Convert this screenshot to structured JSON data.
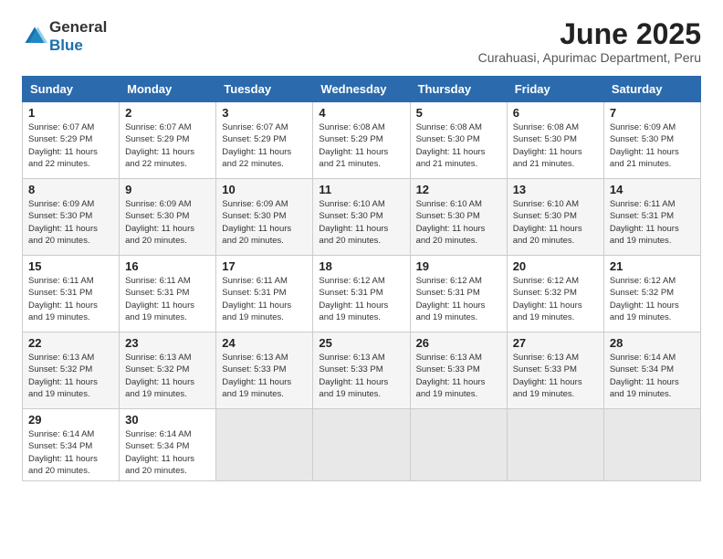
{
  "logo": {
    "general": "General",
    "blue": "Blue"
  },
  "title": "June 2025",
  "subtitle": "Curahuasi, Apurimac Department, Peru",
  "headers": [
    "Sunday",
    "Monday",
    "Tuesday",
    "Wednesday",
    "Thursday",
    "Friday",
    "Saturday"
  ],
  "weeks": [
    [
      {
        "day": "1",
        "info": "Sunrise: 6:07 AM\nSunset: 5:29 PM\nDaylight: 11 hours\nand 22 minutes."
      },
      {
        "day": "2",
        "info": "Sunrise: 6:07 AM\nSunset: 5:29 PM\nDaylight: 11 hours\nand 22 minutes."
      },
      {
        "day": "3",
        "info": "Sunrise: 6:07 AM\nSunset: 5:29 PM\nDaylight: 11 hours\nand 22 minutes."
      },
      {
        "day": "4",
        "info": "Sunrise: 6:08 AM\nSunset: 5:29 PM\nDaylight: 11 hours\nand 21 minutes."
      },
      {
        "day": "5",
        "info": "Sunrise: 6:08 AM\nSunset: 5:30 PM\nDaylight: 11 hours\nand 21 minutes."
      },
      {
        "day": "6",
        "info": "Sunrise: 6:08 AM\nSunset: 5:30 PM\nDaylight: 11 hours\nand 21 minutes."
      },
      {
        "day": "7",
        "info": "Sunrise: 6:09 AM\nSunset: 5:30 PM\nDaylight: 11 hours\nand 21 minutes."
      }
    ],
    [
      {
        "day": "8",
        "info": "Sunrise: 6:09 AM\nSunset: 5:30 PM\nDaylight: 11 hours\nand 20 minutes."
      },
      {
        "day": "9",
        "info": "Sunrise: 6:09 AM\nSunset: 5:30 PM\nDaylight: 11 hours\nand 20 minutes."
      },
      {
        "day": "10",
        "info": "Sunrise: 6:09 AM\nSunset: 5:30 PM\nDaylight: 11 hours\nand 20 minutes."
      },
      {
        "day": "11",
        "info": "Sunrise: 6:10 AM\nSunset: 5:30 PM\nDaylight: 11 hours\nand 20 minutes."
      },
      {
        "day": "12",
        "info": "Sunrise: 6:10 AM\nSunset: 5:30 PM\nDaylight: 11 hours\nand 20 minutes."
      },
      {
        "day": "13",
        "info": "Sunrise: 6:10 AM\nSunset: 5:30 PM\nDaylight: 11 hours\nand 20 minutes."
      },
      {
        "day": "14",
        "info": "Sunrise: 6:11 AM\nSunset: 5:31 PM\nDaylight: 11 hours\nand 19 minutes."
      }
    ],
    [
      {
        "day": "15",
        "info": "Sunrise: 6:11 AM\nSunset: 5:31 PM\nDaylight: 11 hours\nand 19 minutes."
      },
      {
        "day": "16",
        "info": "Sunrise: 6:11 AM\nSunset: 5:31 PM\nDaylight: 11 hours\nand 19 minutes."
      },
      {
        "day": "17",
        "info": "Sunrise: 6:11 AM\nSunset: 5:31 PM\nDaylight: 11 hours\nand 19 minutes."
      },
      {
        "day": "18",
        "info": "Sunrise: 6:12 AM\nSunset: 5:31 PM\nDaylight: 11 hours\nand 19 minutes."
      },
      {
        "day": "19",
        "info": "Sunrise: 6:12 AM\nSunset: 5:31 PM\nDaylight: 11 hours\nand 19 minutes."
      },
      {
        "day": "20",
        "info": "Sunrise: 6:12 AM\nSunset: 5:32 PM\nDaylight: 11 hours\nand 19 minutes."
      },
      {
        "day": "21",
        "info": "Sunrise: 6:12 AM\nSunset: 5:32 PM\nDaylight: 11 hours\nand 19 minutes."
      }
    ],
    [
      {
        "day": "22",
        "info": "Sunrise: 6:13 AM\nSunset: 5:32 PM\nDaylight: 11 hours\nand 19 minutes."
      },
      {
        "day": "23",
        "info": "Sunrise: 6:13 AM\nSunset: 5:32 PM\nDaylight: 11 hours\nand 19 minutes."
      },
      {
        "day": "24",
        "info": "Sunrise: 6:13 AM\nSunset: 5:33 PM\nDaylight: 11 hours\nand 19 minutes."
      },
      {
        "day": "25",
        "info": "Sunrise: 6:13 AM\nSunset: 5:33 PM\nDaylight: 11 hours\nand 19 minutes."
      },
      {
        "day": "26",
        "info": "Sunrise: 6:13 AM\nSunset: 5:33 PM\nDaylight: 11 hours\nand 19 minutes."
      },
      {
        "day": "27",
        "info": "Sunrise: 6:13 AM\nSunset: 5:33 PM\nDaylight: 11 hours\nand 19 minutes."
      },
      {
        "day": "28",
        "info": "Sunrise: 6:14 AM\nSunset: 5:34 PM\nDaylight: 11 hours\nand 19 minutes."
      }
    ],
    [
      {
        "day": "29",
        "info": "Sunrise: 6:14 AM\nSunset: 5:34 PM\nDaylight: 11 hours\nand 20 minutes."
      },
      {
        "day": "30",
        "info": "Sunrise: 6:14 AM\nSunset: 5:34 PM\nDaylight: 11 hours\nand 20 minutes."
      },
      {
        "day": "",
        "info": ""
      },
      {
        "day": "",
        "info": ""
      },
      {
        "day": "",
        "info": ""
      },
      {
        "day": "",
        "info": ""
      },
      {
        "day": "",
        "info": ""
      }
    ]
  ]
}
